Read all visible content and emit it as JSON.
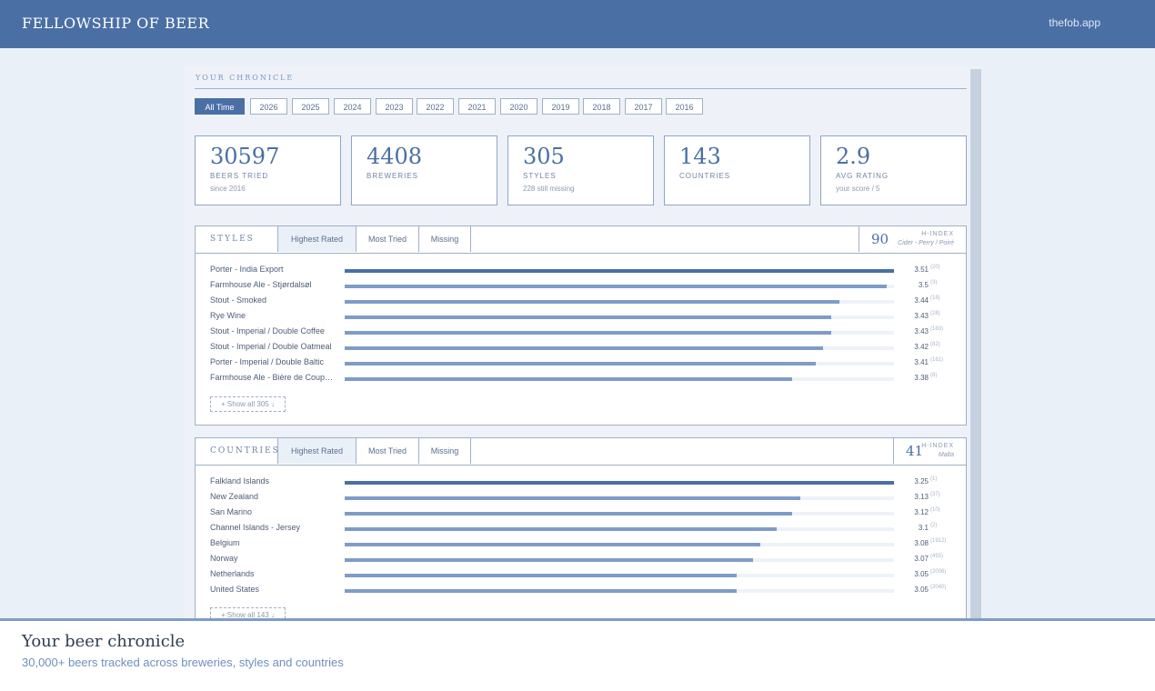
{
  "header": {
    "brand": "FELLOWSHIP OF BEER",
    "site": "thefob.app"
  },
  "chronicle": {
    "title": "YOUR CHRONICLE",
    "years": [
      "All Time",
      "2026",
      "2025",
      "2024",
      "2023",
      "2022",
      "2021",
      "2020",
      "2019",
      "2018",
      "2017",
      "2016"
    ],
    "selected_year": "All Time"
  },
  "stats": [
    {
      "value": "30597",
      "label": "BEERS TRIED",
      "sub": "since 2016"
    },
    {
      "value": "4408",
      "label": "BREWERIES",
      "sub": ""
    },
    {
      "value": "305",
      "label": "STYLES",
      "sub": "228 still missing"
    },
    {
      "value": "143",
      "label": "COUNTRIES",
      "sub": ""
    },
    {
      "value": "2.9",
      "label": "AVG RATING",
      "sub": "your score / 5"
    }
  ],
  "styles": {
    "title": "STYLES",
    "tabs": [
      "Highest Rated",
      "Most Tried",
      "Missing"
    ],
    "active_tab": "Highest Rated",
    "h_index": {
      "value": "90",
      "label": "H-INDEX",
      "sub": "Cider - Perry / Poiré"
    },
    "rows": [
      {
        "name": "Porter - India Export",
        "rating": 3.51,
        "rating_label": "3.51",
        "count": "(20)"
      },
      {
        "name": "Farmhouse Ale - Stjørdalsøl",
        "rating": 3.5,
        "rating_label": "3.5",
        "count": "(3)"
      },
      {
        "name": "Stout - Smoked",
        "rating": 3.44,
        "rating_label": "3.44",
        "count": "(18)"
      },
      {
        "name": "Rye Wine",
        "rating": 3.43,
        "rating_label": "3.43",
        "count": "(28)"
      },
      {
        "name": "Stout - Imperial / Double Coffee",
        "rating": 3.43,
        "rating_label": "3.43",
        "count": "(183)"
      },
      {
        "name": "Stout - Imperial / Double Oatmeal",
        "rating": 3.42,
        "rating_label": "3.42",
        "count": "(82)"
      },
      {
        "name": "Porter - Imperial / Double Baltic",
        "rating": 3.41,
        "rating_label": "3.41",
        "count": "(161)"
      },
      {
        "name": "Farmhouse Ale - Bière de Coupage",
        "rating": 3.38,
        "rating_label": "3.38",
        "count": "(8)"
      }
    ],
    "show_all": "+ Show all 305 ↓"
  },
  "countries": {
    "title": "COUNTRIES",
    "tabs": [
      "Highest Rated",
      "Most Tried",
      "Missing"
    ],
    "active_tab": "Highest Rated",
    "h_index": {
      "value": "41",
      "label": "H-INDEX",
      "sub": "Malta"
    },
    "rows": [
      {
        "name": "Falkland Islands",
        "rating": 3.25,
        "rating_label": "3.25",
        "count": "(1)"
      },
      {
        "name": "New Zealand",
        "rating": 3.13,
        "rating_label": "3.13",
        "count": "(37)"
      },
      {
        "name": "San Marino",
        "rating": 3.12,
        "rating_label": "3.12",
        "count": "(10)"
      },
      {
        "name": "Channel Islands - Jersey",
        "rating": 3.1,
        "rating_label": "3.1",
        "count": "(2)"
      },
      {
        "name": "Belgium",
        "rating": 3.08,
        "rating_label": "3.08",
        "count": "(1912)"
      },
      {
        "name": "Norway",
        "rating": 3.07,
        "rating_label": "3.07",
        "count": "(455)"
      },
      {
        "name": "Netherlands",
        "rating": 3.05,
        "rating_label": "3.05",
        "count": "(2006)"
      },
      {
        "name": "United States",
        "rating": 3.05,
        "rating_label": "3.05",
        "count": "(2040)"
      }
    ],
    "show_all": "+ Show all 143 ↓"
  },
  "footer": {
    "title": "Your beer chronicle",
    "subtitle": "30,000+ beers tracked across breweries, styles and countries"
  },
  "colors": {
    "brand": "#4a6fa5",
    "bar": "#7f9cc8",
    "background": "#eaf0f8"
  }
}
